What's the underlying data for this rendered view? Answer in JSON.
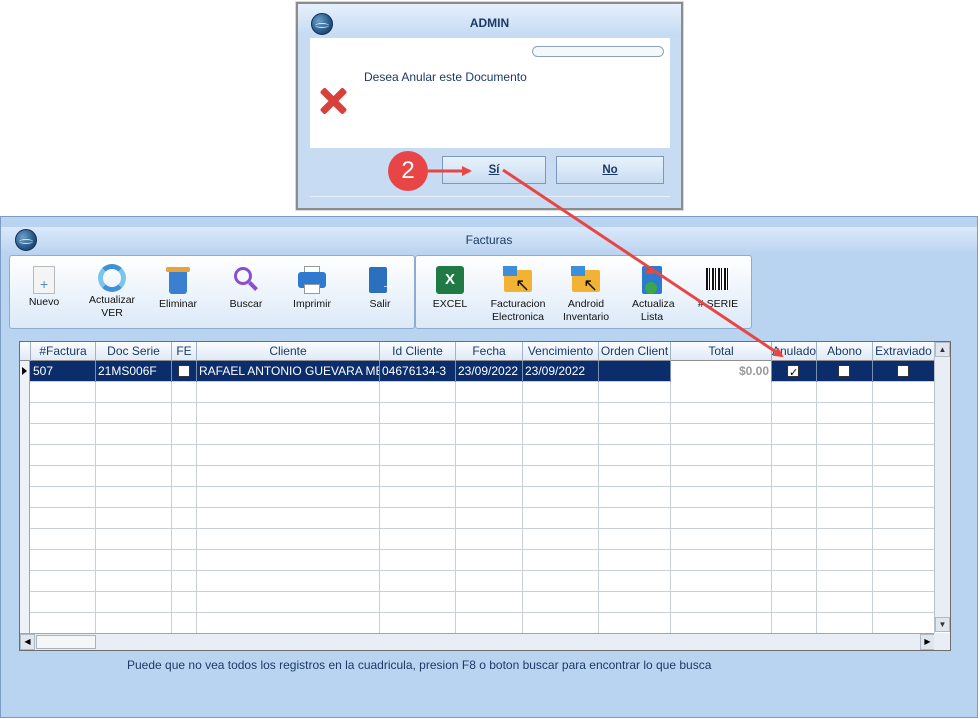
{
  "dialog": {
    "title": "ADMIN",
    "message": "Desea Anular este Documento",
    "yes_label": "Sí",
    "no_label": "No",
    "icon": "error-x-icon"
  },
  "annotation": {
    "step_number": "2",
    "color": "#e84646"
  },
  "main_window": {
    "title": "Facturas",
    "toolbar_left": [
      {
        "label": "Nuevo",
        "icon": "new-document-icon"
      },
      {
        "label": "Actualizar VER",
        "icon": "refresh-icon"
      },
      {
        "label": "Eliminar",
        "icon": "trash-icon"
      },
      {
        "label": "Buscar",
        "icon": "search-icon"
      },
      {
        "label": "Imprimir",
        "icon": "printer-icon"
      },
      {
        "label": "Salir",
        "icon": "exit-icon"
      }
    ],
    "toolbar_right": [
      {
        "label": "EXCEL",
        "icon": "excel-icon"
      },
      {
        "label": "Facturacion Electronica",
        "icon": "folder-cursor-icon"
      },
      {
        "label": "Android Inventario",
        "icon": "folder-cursor-icon"
      },
      {
        "label": "Actualiza Lista",
        "icon": "list-update-icon"
      },
      {
        "label": "# SERIE",
        "icon": "barcode-icon"
      }
    ],
    "grid": {
      "columns": [
        "#Factura",
        "Doc Serie",
        "FE",
        "Cliente",
        "Id Cliente",
        "Fecha",
        "Vencimiento",
        "Orden Client",
        "Total",
        "Anulado",
        "Abono",
        "Extraviado"
      ],
      "rows": [
        {
          "factura": "507",
          "doc_serie": "21MS006F",
          "fe": false,
          "cliente": "RAFAEL ANTONIO GUEVARA ME",
          "id_cliente": "04676134-3",
          "fecha": "23/09/2022",
          "vencimiento": "23/09/2022",
          "orden_cliente": "",
          "total": "$0.00",
          "anulado": true,
          "abono": false,
          "extraviado": false
        }
      ]
    },
    "footer_note": "Puede que no vea todos los registros en la cuadricula, presion F8 o boton buscar para encontrar lo que busca"
  }
}
